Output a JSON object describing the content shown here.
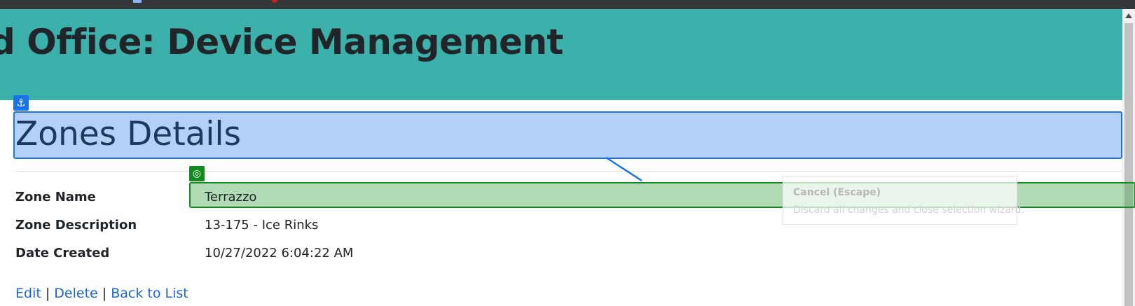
{
  "header": {
    "title": "d Office: Device Management"
  },
  "page": {
    "title": "Zones Details"
  },
  "details": [
    {
      "label": "Zone Name",
      "value": "Terrazzo"
    },
    {
      "label": "Zone Description",
      "value": "13-175 - Ice Rinks"
    },
    {
      "label": "Date Created",
      "value": "10/27/2022 6:04:22 AM"
    }
  ],
  "tooltip": {
    "title": "Cancel (Escape)",
    "description": "Discard all changes and close selection wizard."
  },
  "actions": {
    "edit": "Edit",
    "delete": "Delete",
    "back": "Back to List",
    "separator": "|"
  },
  "icons": {
    "anchor": "anchor-icon",
    "target": "target-icon"
  },
  "colors": {
    "header_bg": "#3cb0aa",
    "selection_blue": "#1a73e8",
    "selection_green": "#128a1f",
    "link": "#1a66d6"
  }
}
